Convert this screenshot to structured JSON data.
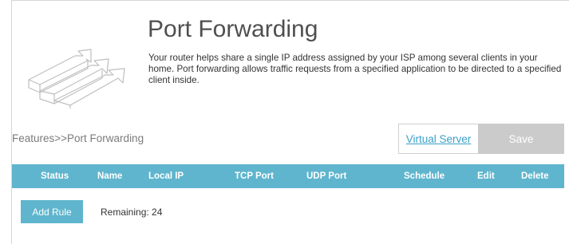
{
  "header": {
    "title": "Port Forwarding",
    "description": "Your router helps share a single IP address assigned by your ISP among several clients in your home. Port forwarding allows traffic requests from a specified application to be directed to a specified client inside."
  },
  "breadcrumb": "Features>>Port Forwarding",
  "toolbar": {
    "virtual_server_label": "Virtual Server",
    "save_label": "Save"
  },
  "table": {
    "columns": [
      "Status",
      "Name",
      "Local IP",
      "TCP Port",
      "UDP Port",
      "Schedule",
      "Edit",
      "Delete"
    ]
  },
  "footer": {
    "add_rule_label": "Add Rule",
    "remaining_text": "Remaining: 24"
  },
  "colors": {
    "accent": "#5fb5cd",
    "link": "#3aa0c8",
    "save_disabled": "#cbcbcb"
  },
  "icons": {
    "logo": "port-forwarding-arrows-icon"
  }
}
